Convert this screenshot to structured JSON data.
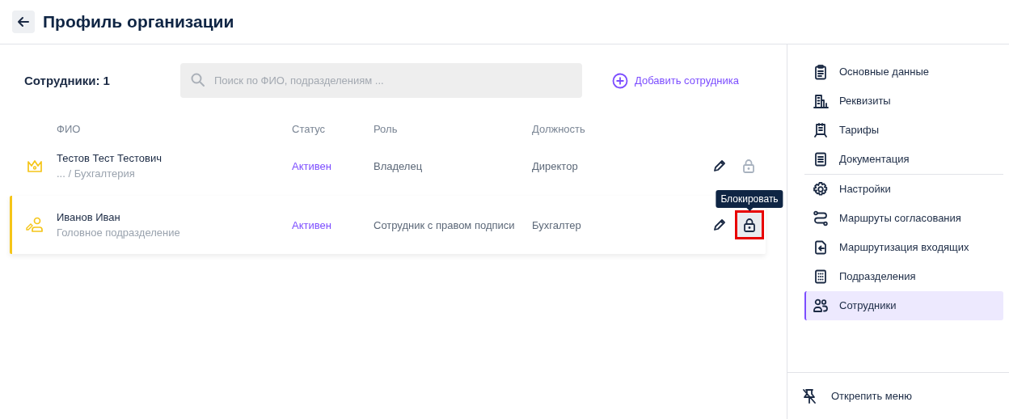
{
  "header": {
    "title": "Профиль организации"
  },
  "employees": {
    "title": "Сотрудники: 1",
    "search": {
      "placeholder": "Поиск по ФИО, подразделениям ..."
    },
    "add_button": "Добавить сотрудника"
  },
  "table": {
    "columns": [
      "ФИО",
      "Статус",
      "Роль",
      "Должность"
    ],
    "rows": [
      {
        "kind": "owner",
        "selected": false,
        "name": "Тестов Тест Тестович",
        "department": "... / Бухгалтерия",
        "status": "Активен",
        "role": "Владелец",
        "position": "Директор",
        "lock_disabled": true,
        "lock_hovered": false
      },
      {
        "kind": "signer",
        "selected": true,
        "name": "Иванов Иван",
        "department": "Головное подразделение",
        "status": "Активен",
        "role": "Сотрудник с правом подписи",
        "position": "Бухгалтер",
        "lock_disabled": false,
        "lock_hovered": true,
        "tooltip": "Блокировать"
      }
    ]
  },
  "sidebar": {
    "sections": [
      [
        {
          "kind": "clipboard",
          "label": "Основные данные",
          "selected": false
        },
        {
          "kind": "building",
          "label": "Реквизиты",
          "selected": false
        },
        {
          "kind": "stand",
          "label": "Тарифы",
          "selected": false
        },
        {
          "kind": "document",
          "label": "Документация",
          "selected": false
        }
      ],
      [
        {
          "kind": "gear",
          "label": "Настройки",
          "selected": false
        },
        {
          "kind": "route",
          "label": "Маршруты согласования",
          "selected": false
        },
        {
          "kind": "incoming",
          "label": "Маршрутизация входящих",
          "selected": false
        },
        {
          "kind": "grid",
          "label": "Подразделения",
          "selected": false
        },
        {
          "kind": "users",
          "label": "Сотрудники",
          "selected": true
        }
      ]
    ],
    "unpin": "Открепить меню"
  }
}
